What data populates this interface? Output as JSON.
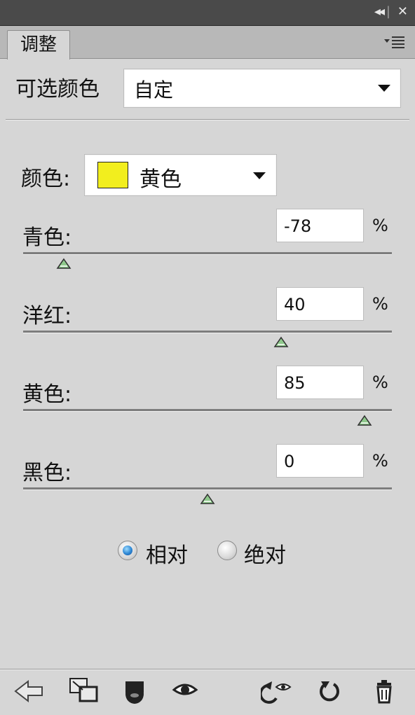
{
  "window": {
    "collapse_icon": "double-arrow-icon",
    "close_icon": "close-icon"
  },
  "tab": {
    "label": "调整",
    "menu_icon": "panel-menu-icon"
  },
  "mode": {
    "label": "可选颜色",
    "preset_value": "自定"
  },
  "color_select": {
    "label": "颜色:",
    "value": "黄色",
    "swatch_color": "#f2ee1e"
  },
  "sliders": [
    {
      "label": "青色:",
      "value": "-78",
      "unit": "%",
      "amount": -78
    },
    {
      "label": "洋红:",
      "value": "40",
      "unit": "%",
      "amount": 40
    },
    {
      "label": "黄色:",
      "value": "85",
      "unit": "%",
      "amount": 85
    },
    {
      "label": "黑色:",
      "value": "0",
      "unit": "%",
      "amount": 0
    }
  ],
  "method": {
    "options": [
      {
        "label": "相对",
        "selected": true
      },
      {
        "label": "绝对",
        "selected": false
      }
    ]
  },
  "toolbar": {
    "icons": [
      "back-arrow-icon",
      "expand-view-icon",
      "clip-layer-icon",
      "visibility-eye-icon",
      "reset-previous-icon",
      "reset-default-icon",
      "trash-icon"
    ]
  },
  "colors": {
    "panel_bg": "#d6d6d6",
    "title_bg": "#4a4a4a",
    "thumb_fill": "#8fc98c"
  }
}
